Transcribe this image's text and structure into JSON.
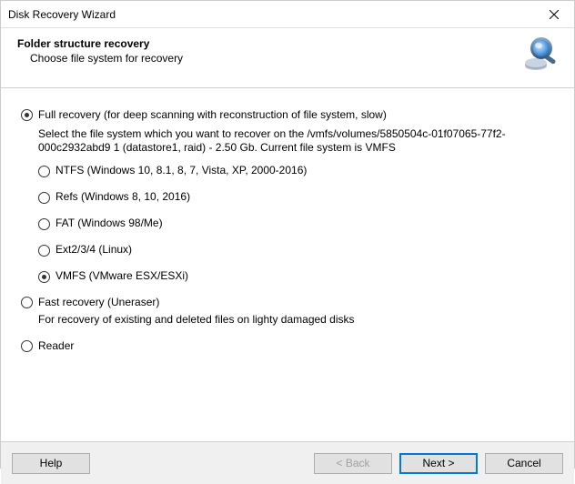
{
  "window": {
    "title": "Disk Recovery Wizard"
  },
  "header": {
    "title": "Folder structure recovery",
    "subtitle": "Choose file system for recovery"
  },
  "modes": {
    "full": {
      "label": "Full recovery (for deep scanning with reconstruction of file system, slow)",
      "selected": true,
      "description": "Select the file system which you want to recover on the /vmfs/volumes/5850504c-01f07065-77f2-000c2932abd9 1 (datastore1, raid) - 2.50 Gb. Current file system is VMFS",
      "filesystems": [
        {
          "label": "NTFS (Windows 10, 8.1, 8, 7, Vista, XP, 2000-2016)",
          "selected": false
        },
        {
          "label": "Refs (Windows 8, 10, 2016)",
          "selected": false
        },
        {
          "label": "FAT (Windows 98/Me)",
          "selected": false
        },
        {
          "label": "Ext2/3/4 (Linux)",
          "selected": false
        },
        {
          "label": "VMFS (VMware ESX/ESXi)",
          "selected": true
        }
      ]
    },
    "fast": {
      "label": "Fast recovery (Uneraser)",
      "selected": false,
      "description": "For recovery of existing and deleted files on lighty damaged disks"
    },
    "reader": {
      "label": "Reader",
      "selected": false
    }
  },
  "footer": {
    "help": "Help",
    "back": "< Back",
    "next": "Next >",
    "cancel": "Cancel"
  }
}
